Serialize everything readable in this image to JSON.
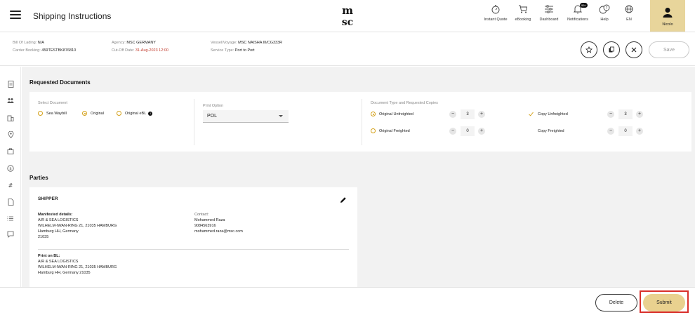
{
  "header": {
    "title": "Shipping Instructions",
    "logo_text": "msc",
    "nav": [
      {
        "label": "Instant Quote",
        "icon": "stopwatch-icon"
      },
      {
        "label": "eBooking",
        "icon": "cart-icon"
      },
      {
        "label": "Dashboard",
        "icon": "sliders-icon"
      },
      {
        "label": "Notifications",
        "icon": "bell-icon",
        "badge": "99+"
      },
      {
        "label": "Help",
        "icon": "help-chat-icon"
      },
      {
        "label": "EN",
        "icon": "globe-icon"
      }
    ],
    "user": {
      "name": "Nicolo",
      "icon": "user-icon"
    }
  },
  "info": {
    "bill_of_lading_label": "Bill Of Lading:",
    "bill_of_lading_value": "N/A",
    "carrier_booking_label": "Carrier Booking:",
    "carrier_booking_value": "459TESTBK876810",
    "agency_label": "Agency:",
    "agency_value": "MSC GERMANY",
    "cutoff_label": "Cut-Off Date:",
    "cutoff_value": "31-Aug-2023 12:00",
    "vessel_label": "Vessel/Voyage:",
    "vessel_value": "MSC NAISHA III/CG333R",
    "service_label": "Service Type:",
    "service_value": "Port to Port",
    "save_label": "Save"
  },
  "requested_documents": {
    "title": "Requested Documents",
    "select_document_label": "Select Document",
    "options": [
      "Sea Waybill",
      "Original",
      "Original eBL"
    ],
    "selected_option": "Original",
    "print_option_label": "Print Option",
    "print_option_value": "POL",
    "doc_type_label": "Document Type and Requested Copies",
    "doc_types": [
      {
        "label": "Original Unfreighted",
        "value": "3",
        "selected": true
      },
      {
        "label": "Original Freighted",
        "value": "0",
        "selected": false
      },
      {
        "label": "Copy Unfreighted",
        "value": "3",
        "checked": true
      },
      {
        "label": "Copy Freighted",
        "value": "0",
        "checked": false
      }
    ],
    "minus": "−",
    "plus": "+"
  },
  "parties": {
    "title": "Parties",
    "shipper": {
      "title": "SHIPPER",
      "manifested_label": "Manifested details:",
      "manifested_lines": [
        "AIR & SEA LOGISTICS",
        "WILHELM-IWAN-RING 21, 21035 HAMBURG",
        "Hamburg HH, Germany",
        "21035"
      ],
      "contact_label": "Contact:",
      "contact_lines": [
        "Mohammed Raza",
        "9084563916",
        "mohammed.raza@msc.com"
      ],
      "print_label": "Print on BL:",
      "print_lines": [
        "AIR & SEA LOGISTICS",
        "WILHELM-IWAN-RING 21, 21035 HAMBURG",
        "Hamburg HH, Germany 21035"
      ]
    }
  },
  "footer": {
    "delete_label": "Delete",
    "submit_label": "Submit"
  },
  "colors": {
    "accent": "#e9d18f",
    "highlight": "#d9302c",
    "radio": "#d4a017"
  }
}
